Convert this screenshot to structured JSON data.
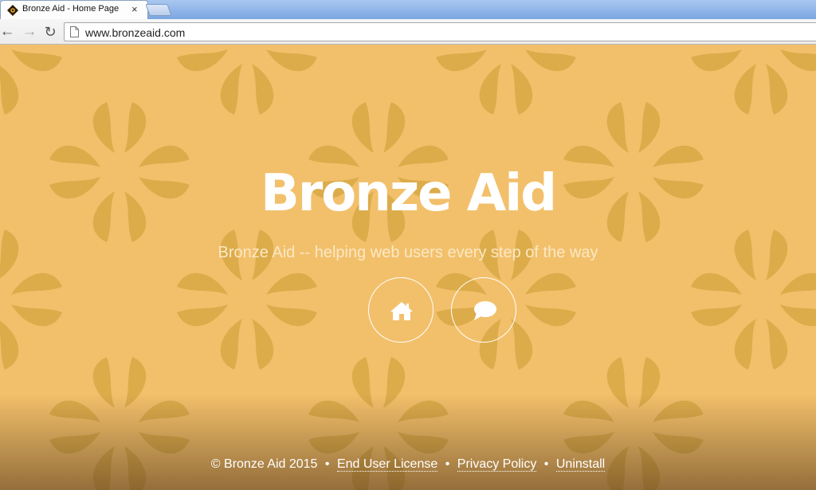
{
  "browser": {
    "tab_title": "Bronze Aid - Home Page",
    "tab_close": "×",
    "url": "www.bronzeaid.com",
    "nav": {
      "back": "←",
      "forward": "→",
      "reload": "↻"
    }
  },
  "hero": {
    "title": "Bronze Aid",
    "subtitle": "Bronze Aid -- helping web users every step of the way",
    "buttons": [
      {
        "icon": "home-icon"
      },
      {
        "icon": "chat-bubble-icon"
      }
    ]
  },
  "footer": {
    "copyright": "© Bronze Aid 2015",
    "separator": "•",
    "links": [
      "End User License",
      "Privacy Policy",
      "Uninstall"
    ]
  },
  "colors": {
    "background": "#f2c06b",
    "pattern": "#d9a846",
    "text": "#ffffff"
  }
}
